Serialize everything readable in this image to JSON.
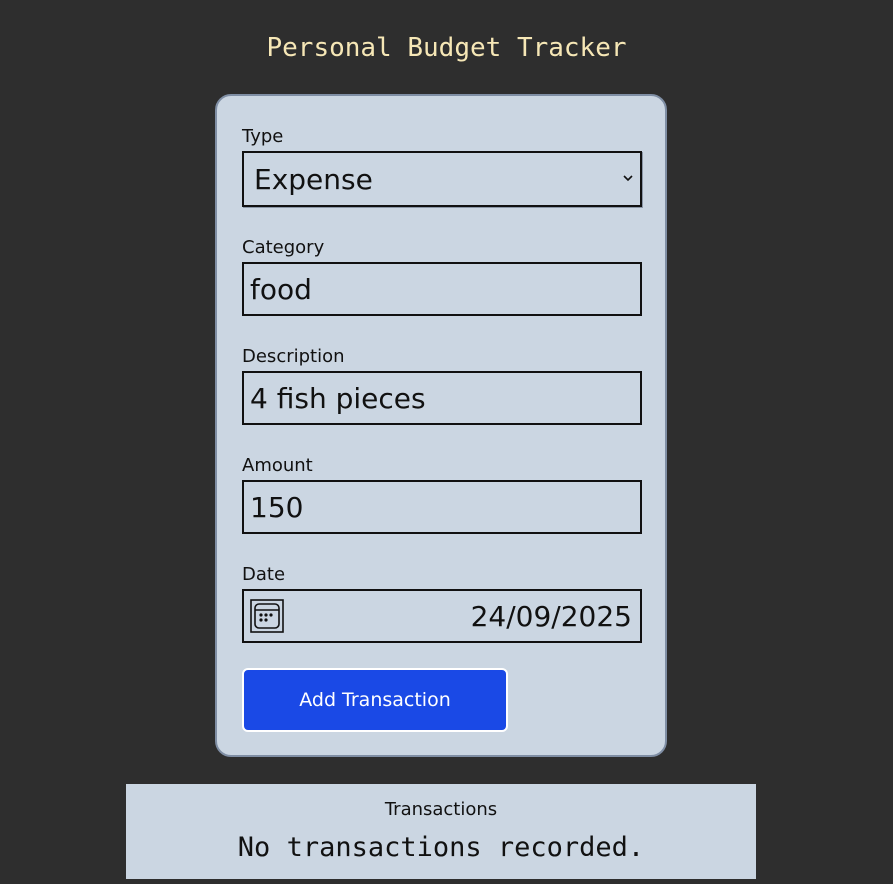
{
  "header": {
    "title": "Personal Budget Tracker"
  },
  "form": {
    "type": {
      "label": "Type",
      "selected": "Expense",
      "icon": "chevron-down-icon"
    },
    "category": {
      "label": "Category",
      "value": "food"
    },
    "description": {
      "label": "Description",
      "value": "4 fish pieces"
    },
    "amount": {
      "label": "Amount",
      "value": "150"
    },
    "date": {
      "label": "Date",
      "value": "24/09/2025",
      "icon": "calendar-icon"
    },
    "submit_label": "Add Transaction"
  },
  "transactions": {
    "heading": "Transactions",
    "empty_message": "No transactions recorded."
  },
  "colors": {
    "background": "#2e2e2e",
    "title": "#f6e7b6",
    "card": "#cbd6e2",
    "button": "#1a49e6"
  }
}
